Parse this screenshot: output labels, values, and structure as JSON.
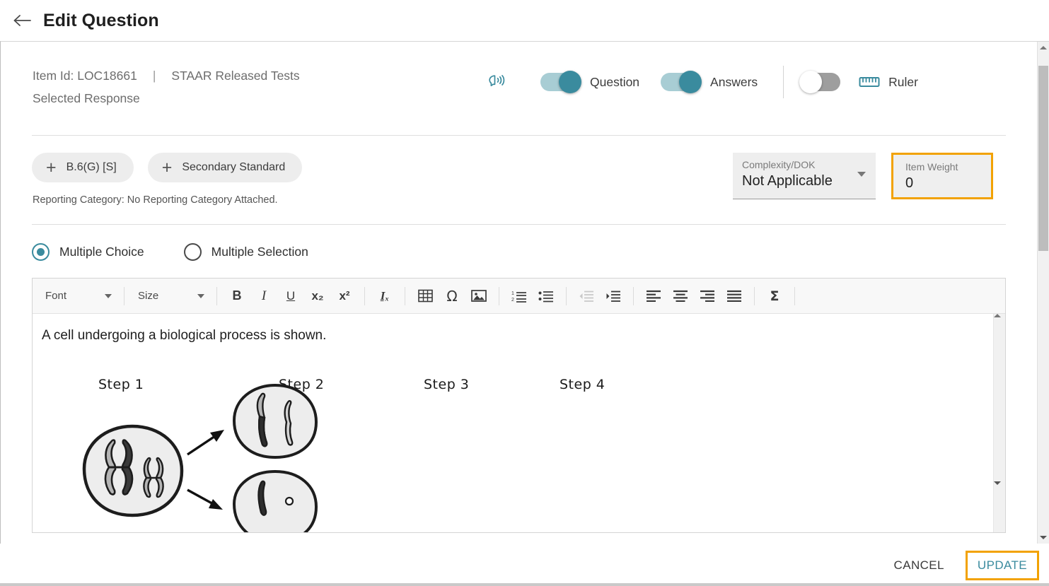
{
  "titlebar": {
    "back_icon": "arrow-left-icon",
    "title": "Edit Question"
  },
  "meta": {
    "item_id": "Item Id: LOC18661",
    "separator": "|",
    "source": "STAAR Released Tests",
    "response_type": "Selected Response",
    "tts_icon": "text-to-speech-icon",
    "toggles": [
      {
        "label": "Question",
        "state": "on"
      },
      {
        "label": "Answers",
        "state": "on"
      }
    ],
    "ruler": {
      "label": "Ruler",
      "state": "off",
      "icon": "ruler-icon"
    }
  },
  "standards": {
    "chips": [
      {
        "plus": "+",
        "label": "B.6(G) [S]"
      },
      {
        "plus": "+",
        "label": "Secondary Standard"
      }
    ],
    "reporting_category": "Reporting Category: No Reporting Category Attached."
  },
  "fields": {
    "complexity": {
      "label": "Complexity/DOK",
      "value": "Not Applicable",
      "caret_icon": "chevron-down-icon"
    },
    "item_weight": {
      "label": "Item Weight",
      "value": "0",
      "highlight_color": "#f2a203"
    }
  },
  "question_type": {
    "options": [
      {
        "label": "Multiple Choice",
        "selected": true
      },
      {
        "label": "Multiple Selection",
        "selected": false
      }
    ],
    "accent_color": "#3a8b9e"
  },
  "editor": {
    "toolbar": {
      "font_label": "Font",
      "size_label": "Size",
      "buttons": [
        {
          "name": "bold-icon",
          "glyph": "B",
          "disabled": false
        },
        {
          "name": "italic-icon",
          "glyph": "I",
          "disabled": false
        },
        {
          "name": "underline-icon",
          "glyph": "U",
          "disabled": false
        },
        {
          "name": "subscript-icon",
          "glyph": "x₂",
          "disabled": false
        },
        {
          "name": "superscript-icon",
          "glyph": "x²",
          "disabled": false
        },
        {
          "name": "remove-format-icon",
          "glyph": "Iₓ",
          "disabled": false
        },
        {
          "name": "table-icon",
          "glyph": "▦",
          "disabled": false
        },
        {
          "name": "special-character-icon",
          "glyph": "Ω",
          "disabled": false
        },
        {
          "name": "image-icon",
          "glyph": "Ὓc",
          "disabled": false
        },
        {
          "name": "numbered-list-icon",
          "glyph": "",
          "disabled": false
        },
        {
          "name": "bulleted-list-icon",
          "glyph": "",
          "disabled": false
        },
        {
          "name": "outdent-icon",
          "glyph": "",
          "disabled": true
        },
        {
          "name": "indent-icon",
          "glyph": "",
          "disabled": false
        },
        {
          "name": "align-left-icon",
          "glyph": "",
          "disabled": false
        },
        {
          "name": "align-center-icon",
          "glyph": "",
          "disabled": false
        },
        {
          "name": "align-right-icon",
          "glyph": "",
          "disabled": false
        },
        {
          "name": "align-justify-icon",
          "glyph": "",
          "disabled": false
        },
        {
          "name": "math-sigma-icon",
          "glyph": "Σ",
          "disabled": false
        }
      ]
    },
    "content": {
      "prompt": "A cell undergoing a biological process is shown.",
      "step_labels": [
        "Step 1",
        "Step 2",
        "Step 3",
        "Step 4"
      ],
      "diagram_alt": "cell-division-diagram"
    }
  },
  "footer": {
    "cancel_label": "CANCEL",
    "update_label": "UPDATE",
    "update_color": "#3a8b9e",
    "update_highlight": "#f2a203"
  },
  "scrollbars": {
    "outer": {
      "up_icon": "scroll-up-icon",
      "down_icon": "scroll-down-icon"
    },
    "inner": {
      "up_icon": "scroll-up-icon",
      "down_icon": "scroll-down-icon"
    }
  }
}
